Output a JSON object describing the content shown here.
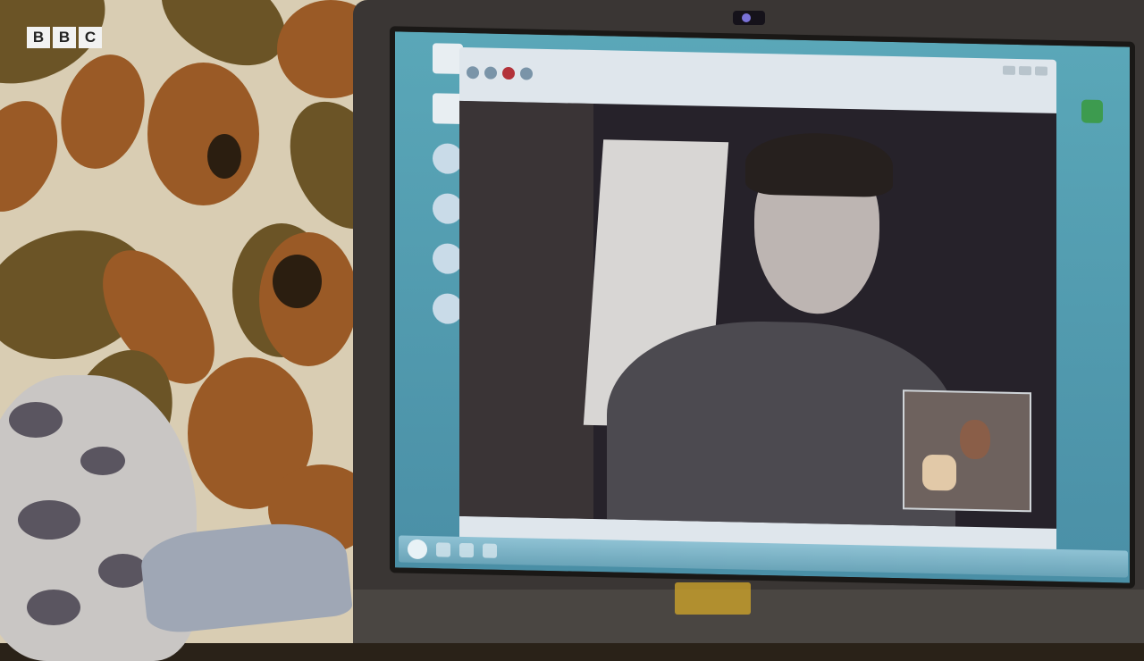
{
  "broadcaster": {
    "logo_letters": [
      "B",
      "B",
      "C"
    ]
  },
  "colors": {
    "wallpaper_base": "#d9cdb3",
    "wallpaper_orange": "#9a5a26",
    "wallpaper_olive": "#6b5426",
    "desktop_blue": "#5aa7b8",
    "laptop_bezel": "#3a3634",
    "record_button": "#b3323a"
  },
  "screen": {
    "desktop_icons": [
      "computer-icon",
      "folder-icon",
      "network-icon",
      "network-share-icon",
      "globe-icon",
      "media-icon"
    ],
    "tray_icon": "app-tray-icon",
    "chat_window": {
      "toolbar_icons": [
        "contact-icon",
        "back-icon",
        "record-icon",
        "settings-icon"
      ]
    },
    "taskbar_items": [
      "start-orb-icon",
      "browser-icon",
      "folder-icon",
      "messenger-icon"
    ]
  }
}
